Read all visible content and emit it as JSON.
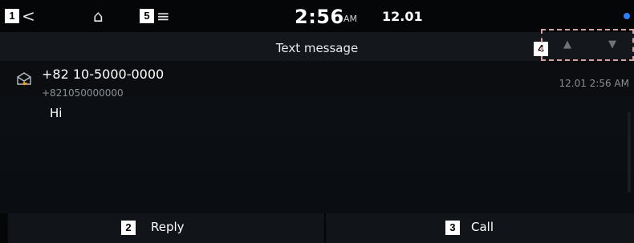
{
  "callouts": [
    "1",
    "2",
    "3",
    "4",
    "5"
  ],
  "statusbar": {
    "back_icon": "<",
    "home_icon": "⌂",
    "menu_icon": "≡",
    "time": "2:56",
    "ampm": "AM",
    "date": "12.01"
  },
  "header": {
    "title": "Text message",
    "prev_icon": "▲",
    "next_icon": "▼"
  },
  "message": {
    "contact": "+82 10-5000-0000",
    "number": "+821050000000",
    "timestamp": "12.01 2:56 AM",
    "body": "Hi"
  },
  "actions": {
    "reply": "Reply",
    "call": "Call"
  },
  "colors": {
    "background": "#0b0d10",
    "accent_blue": "#2d7ff9",
    "callout_border": "#d9a3a3"
  }
}
